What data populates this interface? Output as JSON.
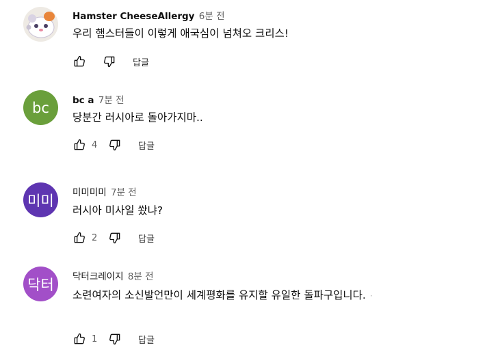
{
  "colors": {
    "avatar_bc": "#6a9f3b",
    "avatar_mimi": "#5e35b1",
    "avatar_doctor": "#a24fc8"
  },
  "comments": [
    {
      "author": "Hamster CheeseAllergy",
      "time": "6분 전",
      "text": "우리 햄스터들이 이렇게 애국심이 넘쳐오 크리스!",
      "likes": "",
      "reply_label": "답글",
      "avatar_icon": "hamster-avatar"
    },
    {
      "author": "bc a",
      "time": "7분 전",
      "text": "당분간 러시아로 돌아가지마..",
      "likes": "4",
      "reply_label": "답글",
      "avatar_text": "bc"
    },
    {
      "author": "미미미미",
      "time": "7분 전",
      "text": "러시아 미사일 쐈냐?",
      "likes": "2",
      "reply_label": "답글",
      "avatar_text": "미미"
    },
    {
      "author": "닥터크레이지",
      "time": "8분 전",
      "text": "소련여자의 소신발언만이 세계평화를 유지할 유일한 돌파구입니다.",
      "likes": "1",
      "reply_label": "답글",
      "avatar_text": "닥터"
    }
  ]
}
